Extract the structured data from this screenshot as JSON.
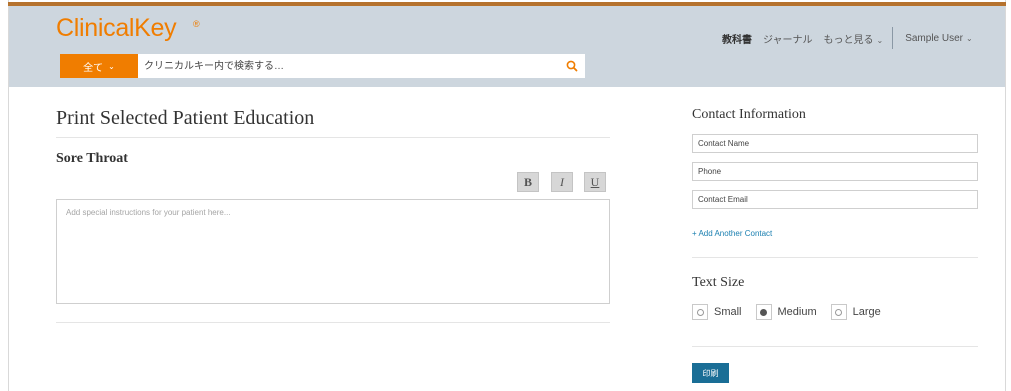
{
  "colors": {
    "brand_orange": "#f07d00",
    "header_bg": "#cdd6de",
    "link_blue": "#1a7fb0",
    "print_button": "#1a6e96"
  },
  "header": {
    "logo": "ClinicalKey",
    "logo_mark": "®",
    "search": {
      "scope_label": "全て",
      "scope_icon": "chevron-down-icon",
      "placeholder": "クリニカルキー内で検索する…",
      "icon": "search-icon"
    },
    "nav": {
      "items": [
        "教科書",
        "ジャーナル",
        "もっと見る"
      ],
      "user": "Sample User"
    }
  },
  "main": {
    "title": "Print Selected Patient Education",
    "topic": "Sore Throat",
    "formatting": {
      "bold": "B",
      "italic": "I",
      "underline": "U"
    },
    "instructions_placeholder": "Add special instructions for your patient here..."
  },
  "sidebar": {
    "contact": {
      "title": "Contact Information",
      "name_placeholder": "Contact Name",
      "phone_placeholder": "Phone",
      "email_placeholder": "Contact Email",
      "add_link": "+ Add Another Contact"
    },
    "text_size": {
      "title": "Text Size",
      "options": [
        {
          "label": "Small",
          "selected": false
        },
        {
          "label": "Medium",
          "selected": true
        },
        {
          "label": "Large",
          "selected": false
        }
      ]
    },
    "print_label": "印刷"
  }
}
